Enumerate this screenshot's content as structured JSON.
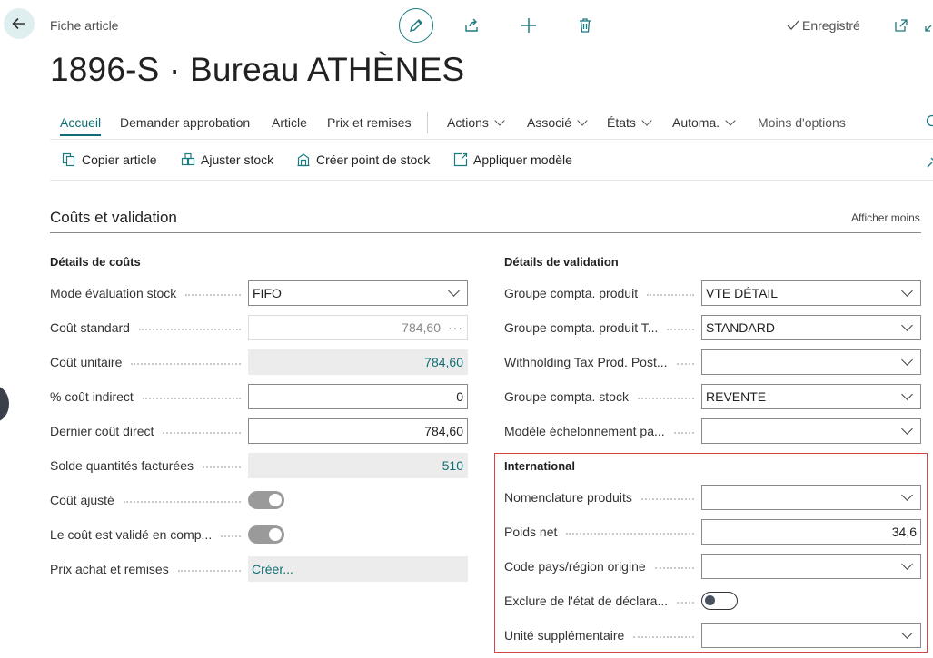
{
  "header": {
    "page_type": "Fiche article",
    "title": "1896-S · Bureau ATHÈNES",
    "saved_status": "Enregistré"
  },
  "tabs": [
    {
      "label": "Accueil"
    },
    {
      "label": "Demander approbation"
    },
    {
      "label": "Article"
    },
    {
      "label": "Prix et remises"
    },
    {
      "label": "Actions"
    },
    {
      "label": "Associé"
    },
    {
      "label": "États"
    },
    {
      "label": "Automa."
    },
    {
      "label": "Moins d'options"
    }
  ],
  "actions": [
    {
      "label": "Copier article"
    },
    {
      "label": "Ajuster stock"
    },
    {
      "label": "Créer point de stock"
    },
    {
      "label": "Appliquer modèle"
    }
  ],
  "section": {
    "title": "Coûts et validation",
    "toggle_label": "Afficher moins"
  },
  "costs": {
    "heading": "Détails de coûts",
    "fields": [
      {
        "label": "Mode évaluation stock",
        "value": "FIFO"
      },
      {
        "label": "Coût standard",
        "value": "784,60"
      },
      {
        "label": "Coût unitaire",
        "value": "784,60"
      },
      {
        "label": "% coût indirect",
        "value": "0"
      },
      {
        "label": "Dernier coût direct",
        "value": "784,60"
      },
      {
        "label": "Solde quantités facturées",
        "value": "510"
      },
      {
        "label": "Coût ajusté",
        "value": true
      },
      {
        "label": "Le coût est validé en comp...",
        "value": true
      },
      {
        "label": "Prix achat et remises",
        "value": "Créer..."
      }
    ]
  },
  "posting": {
    "heading": "Détails de validation",
    "fields": [
      {
        "label": "Groupe compta. produit",
        "value": "VTE DÉTAIL"
      },
      {
        "label": "Groupe compta. produit T...",
        "value": "STANDARD"
      },
      {
        "label": "Withholding Tax Prod. Post...",
        "value": ""
      },
      {
        "label": "Groupe compta. stock",
        "value": "REVENTE"
      },
      {
        "label": "Modèle échelonnement pa...",
        "value": ""
      }
    ]
  },
  "international": {
    "heading": "International",
    "fields": [
      {
        "label": "Nomenclature produits",
        "value": ""
      },
      {
        "label": "Poids net",
        "value": "34,6"
      },
      {
        "label": "Code pays/région origine",
        "value": ""
      },
      {
        "label": "Exclure de l'état de déclara...",
        "value": false
      },
      {
        "label": "Unité supplémentaire",
        "value": ""
      }
    ]
  },
  "colors": {
    "accent": "#0f6e73",
    "highlight": "#d64545"
  }
}
